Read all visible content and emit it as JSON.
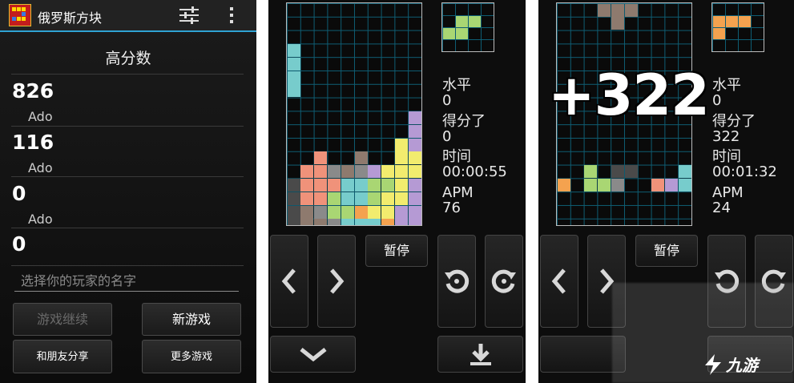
{
  "app": {
    "title": "俄罗斯方块"
  },
  "highscores": {
    "title": "高分数",
    "entries": [
      {
        "score": "826",
        "name": "Ado"
      },
      {
        "score": "116",
        "name": "Ado"
      },
      {
        "score": "0",
        "name": "Ado"
      },
      {
        "score": "0",
        "name": ""
      }
    ],
    "player_placeholder": "选择你的玩家的名字",
    "continue_label": "游戏继续",
    "new_game_label": "新游戏",
    "share_label": "和朋友分享",
    "more_games_label": "更多游戏"
  },
  "game1": {
    "level_label": "水平",
    "level": "0",
    "score_label": "得分了",
    "score": "0",
    "time_label": "时间",
    "time": "00:00:55",
    "apm_label": "APM",
    "apm": "76",
    "pause_label": "暂停"
  },
  "game2": {
    "level_label": "水平",
    "level": "0",
    "score_label": "得分了",
    "score": "322",
    "time_label": "时间",
    "time": "00:01:32",
    "apm_label": "APM",
    "apm": "24",
    "pause_label": "暂停",
    "bonus": "+322"
  },
  "watermark": {
    "text": "九游"
  },
  "colors": {
    "accent": "#2fa3d3",
    "grid": "#0e5d73",
    "cyan": "#77cccc",
    "salmon": "#f0927a",
    "lavender": "#b59ad4",
    "yellow": "#f2ec6e",
    "green": "#a9d673",
    "orange": "#f4a24f",
    "brown": "#8e7a6e",
    "gray": "#8a8a8a",
    "darkgray": "#4a4a4a"
  }
}
